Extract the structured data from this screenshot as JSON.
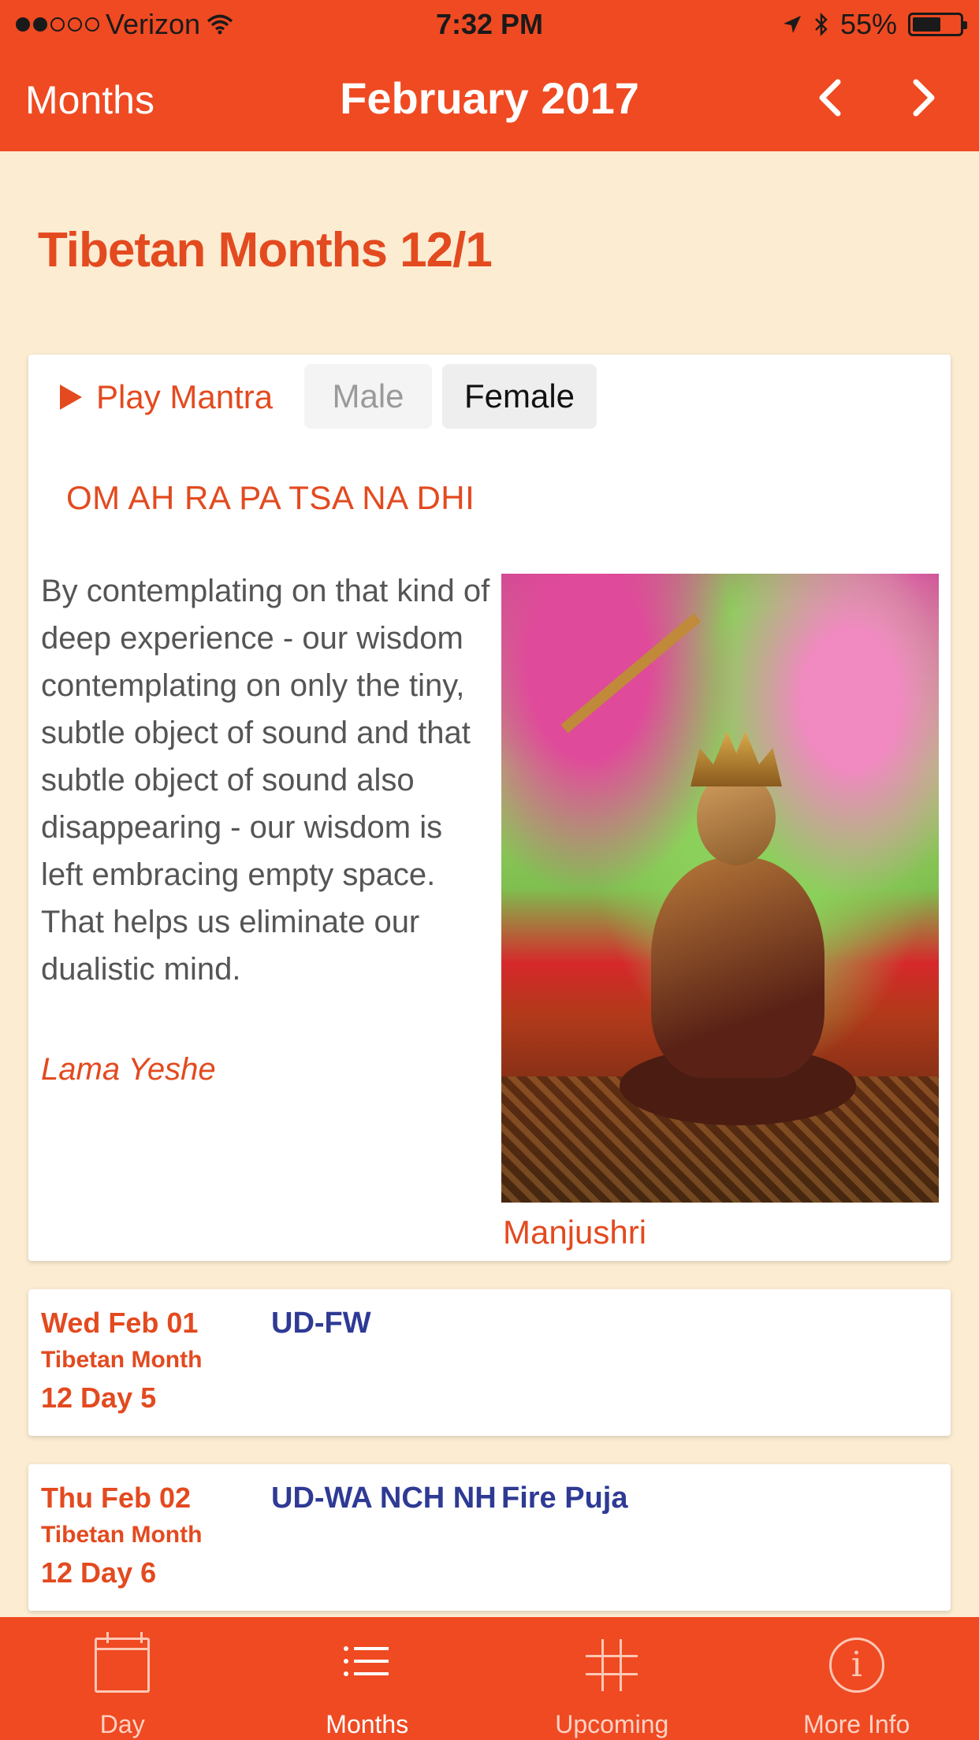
{
  "status": {
    "carrier": "Verizon",
    "time": "7:32 PM",
    "battery": "55%",
    "battery_level": 0.55
  },
  "nav": {
    "back_label": "Months",
    "title": "February 2017",
    "prev_glyph": "‹",
    "next_glyph": "›"
  },
  "heading": "Tibetan Months 12/1",
  "mantra_card": {
    "play_label": "Play Mantra",
    "voice_options": [
      "Male",
      "Female"
    ],
    "selected_voice": "Female",
    "mantra": "OM AH RA PA TSA NA DHI",
    "quote": "By contemplating on that kind of deep experience - our wisdom contemplating on only the tiny, subtle object of sound and that subtle object of sound also disappearing - our wisdom is left embracing empty space. That helps us eliminate our dualistic mind.",
    "author": "Lama Yeshe",
    "image_caption": "Manjushri"
  },
  "events": [
    {
      "day": "Wed Feb 01",
      "month_label": "Tibetan Month",
      "tibetan_day": "12 Day 5",
      "codes": [
        "UD-FW"
      ]
    },
    {
      "day": "Thu Feb 02",
      "month_label": "Tibetan Month",
      "tibetan_day": "12 Day 6",
      "codes": [
        "UD-WA NCH NH",
        "Fire Puja"
      ]
    }
  ],
  "tabs": [
    {
      "label": "Day",
      "icon": "calendar-icon"
    },
    {
      "label": "Months",
      "icon": "list-icon"
    },
    {
      "label": "Upcoming",
      "icon": "grid-icon"
    },
    {
      "label": "More Info",
      "icon": "info-icon"
    }
  ],
  "active_tab": "Months",
  "colors": {
    "accent": "#ef4a22",
    "background": "#fbecd2",
    "text_red": "#e34a1f",
    "code_blue": "#2e3a94"
  }
}
